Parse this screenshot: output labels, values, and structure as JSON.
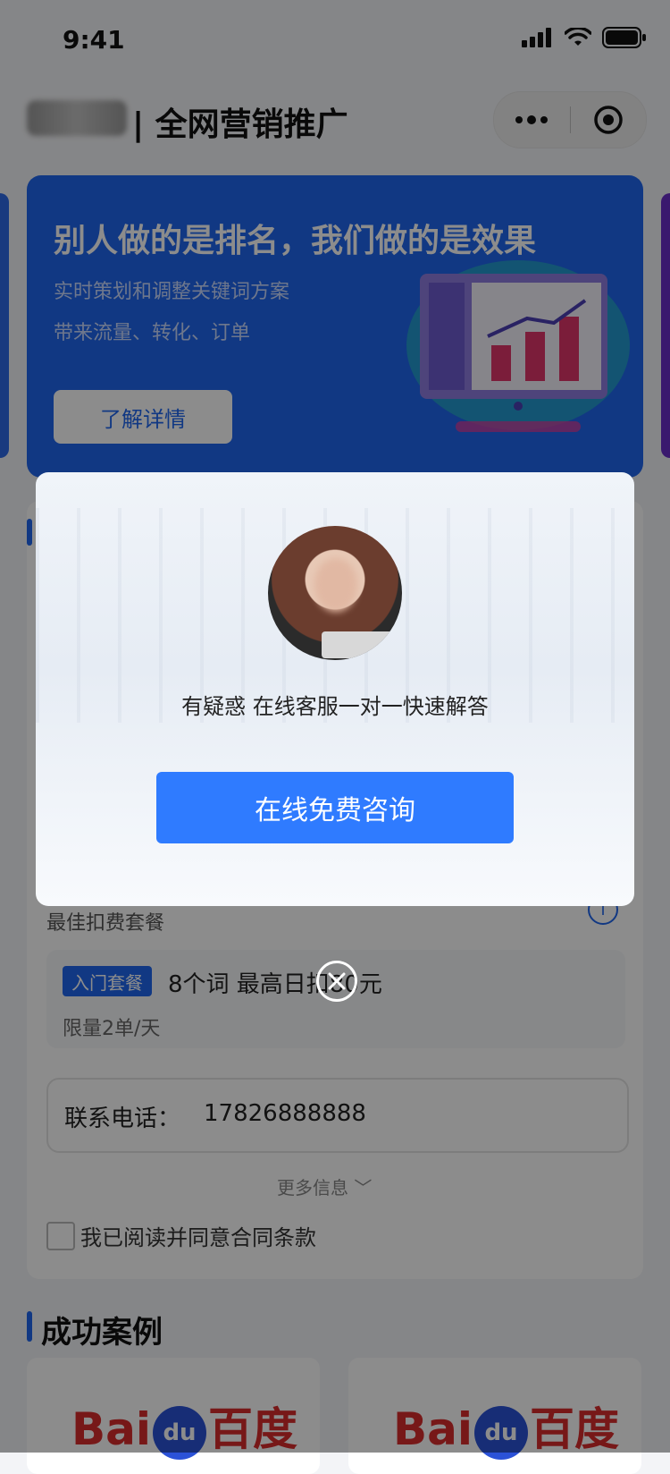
{
  "status_bar": {
    "time": "9:41",
    "icons": [
      "signal-icon",
      "wifi-icon",
      "battery-icon"
    ]
  },
  "nav": {
    "title": "| 全网营销推广",
    "capsule_icons": [
      "more-icon",
      "target-icon"
    ]
  },
  "banner": {
    "headline": "别人做的是排名，我们做的是效果",
    "sub1": "实时策划和调整关键词方案",
    "sub2": "带来流量、转化、订单",
    "button": "了解详情"
  },
  "form": {
    "package_label": "最佳扣费套餐",
    "package_tag": "入门套餐",
    "package_desc": "8个词  最高日扣80元",
    "package_limit": "限量2单/天",
    "phone_label": "联系电话：",
    "phone_value": "17826888888",
    "more_info": "更多信息 ﹀",
    "agree": "我已阅读并同意合同条款"
  },
  "cases": {
    "title": "成功案例",
    "items": [
      {
        "logo_text_a": "Bai",
        "logo_text_du": "du",
        "logo_text_b": "百度"
      },
      {
        "logo_text_a": "Bai",
        "logo_text_du": "du",
        "logo_text_b": "百度"
      }
    ]
  },
  "modal": {
    "message": "有疑惑 在线客服一对一快速解答",
    "button": "在线免费咨询"
  },
  "colors": {
    "primary": "#2f7bff",
    "banner": "#1f66ee",
    "overlay": "rgba(0,0,0,0.45)"
  }
}
